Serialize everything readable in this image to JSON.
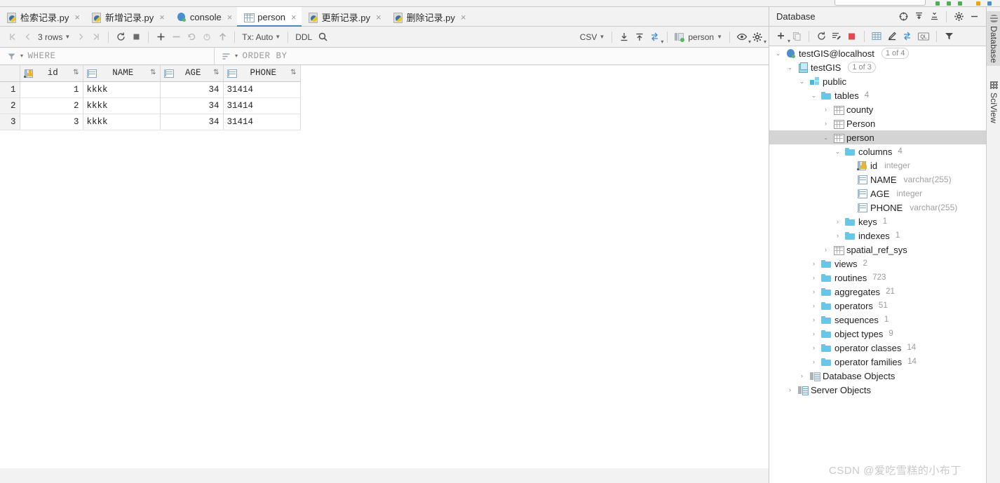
{
  "window": {
    "top_strip_dots": [
      "#4caf50",
      "#4caf50",
      "#4caf50",
      "#f0a500",
      "#4c8fce"
    ]
  },
  "editor_tabs": [
    {
      "label": "检索记录.py",
      "icon": "python-file-icon",
      "active": false,
      "close": "×"
    },
    {
      "label": "新增记录.py",
      "icon": "python-file-icon",
      "active": false,
      "close": "×"
    },
    {
      "label": "console",
      "icon": "postgres-console-icon",
      "active": false,
      "close": "×"
    },
    {
      "label": "person",
      "icon": "table-icon",
      "active": true,
      "close": "×"
    },
    {
      "label": "更新记录.py",
      "icon": "python-file-icon",
      "active": false,
      "close": "×"
    },
    {
      "label": "删除记录.py",
      "icon": "python-file-icon",
      "active": false,
      "close": "×"
    }
  ],
  "grid_toolbar": {
    "first_page": "|<",
    "prev_page": "<",
    "rows_label": "3 rows",
    "next_page": ">",
    "last_page": ">|",
    "reload": "reload-icon",
    "stop": "stop-icon",
    "add_row": "+",
    "delete_row": "−",
    "revert": "revert-icon",
    "revert_selected": "revert-selected-icon",
    "submit": "submit-icon",
    "tx_label": "Tx: Auto",
    "ddl_label": "DDL",
    "search": "search-icon",
    "format_label": "CSV",
    "import_label": "import-icon",
    "export_label": "export-icon",
    "compare_label": "compare-icon",
    "session_label": "person",
    "view_options": "eye-icon",
    "settings": "gear-icon"
  },
  "filter_bar": {
    "where_placeholder": "WHERE",
    "order_by_placeholder": "ORDER BY"
  },
  "table": {
    "columns": [
      {
        "name": "id",
        "icon": "primary-key-column-icon",
        "align": "right"
      },
      {
        "name": "NAME",
        "icon": "column-icon",
        "align": "left"
      },
      {
        "name": "AGE",
        "icon": "column-icon",
        "align": "right"
      },
      {
        "name": "PHONE",
        "icon": "column-icon",
        "align": "left"
      }
    ],
    "rows": [
      {
        "n": "1",
        "id": "1",
        "NAME": "kkkk",
        "AGE": "34",
        "PHONE": "31414"
      },
      {
        "n": "2",
        "id": "2",
        "NAME": "kkkk",
        "AGE": "34",
        "PHONE": "31414"
      },
      {
        "n": "3",
        "id": "3",
        "NAME": "kkkk",
        "AGE": "34",
        "PHONE": "31414"
      }
    ]
  },
  "database_panel": {
    "title": "Database",
    "header_buttons": [
      "jump-to-source-icon",
      "expand-all-icon",
      "collapse-all-icon",
      "gear-icon",
      "hide-icon"
    ],
    "toolbar_buttons": [
      "add-icon",
      "copy-icon",
      "refresh-icon",
      "sync-icon",
      "stop-icon",
      "table-editor-icon",
      "modify-icon",
      "jump-to-console-icon",
      "query-console-icon",
      "filter-icon"
    ],
    "tree": [
      {
        "depth": 0,
        "arrow": "⌄",
        "icon": "postgres-datasource-icon",
        "label": "testGIS@localhost",
        "badge": "1 of 4",
        "selected": false
      },
      {
        "depth": 1,
        "arrow": "⌄",
        "icon": "database-icon",
        "label": "testGIS",
        "badge": "1 of 3",
        "selected": false
      },
      {
        "depth": 2,
        "arrow": "⌄",
        "icon": "schema-icon",
        "label": "public",
        "selected": false
      },
      {
        "depth": 3,
        "arrow": "⌄",
        "icon": "folder-icon",
        "label": "tables",
        "count": "4",
        "selected": false
      },
      {
        "depth": 4,
        "arrow": "›",
        "icon": "table-icon",
        "label": "county",
        "selected": false
      },
      {
        "depth": 4,
        "arrow": "›",
        "icon": "table-icon",
        "label": "Person",
        "selected": false
      },
      {
        "depth": 4,
        "arrow": "⌄",
        "icon": "table-icon",
        "label": "person",
        "selected": true
      },
      {
        "depth": 5,
        "arrow": "⌄",
        "icon": "folder-icon",
        "label": "columns",
        "count": "4",
        "selected": false
      },
      {
        "depth": 6,
        "arrow": "",
        "icon": "primary-key-column-icon",
        "label": "id",
        "type": "integer",
        "selected": false
      },
      {
        "depth": 6,
        "arrow": "",
        "icon": "column-icon",
        "label": "NAME",
        "type": "varchar(255)",
        "selected": false
      },
      {
        "depth": 6,
        "arrow": "",
        "icon": "column-icon",
        "label": "AGE",
        "type": "integer",
        "selected": false
      },
      {
        "depth": 6,
        "arrow": "",
        "icon": "column-icon",
        "label": "PHONE",
        "type": "varchar(255)",
        "selected": false
      },
      {
        "depth": 5,
        "arrow": "›",
        "icon": "folder-icon",
        "label": "keys",
        "count": "1",
        "selected": false
      },
      {
        "depth": 5,
        "arrow": "›",
        "icon": "folder-icon",
        "label": "indexes",
        "count": "1",
        "selected": false
      },
      {
        "depth": 4,
        "arrow": "›",
        "icon": "table-icon",
        "label": "spatial_ref_sys",
        "selected": false
      },
      {
        "depth": 3,
        "arrow": "›",
        "icon": "folder-icon",
        "label": "views",
        "count": "2",
        "selected": false
      },
      {
        "depth": 3,
        "arrow": "›",
        "icon": "folder-icon",
        "label": "routines",
        "count": "723",
        "selected": false
      },
      {
        "depth": 3,
        "arrow": "›",
        "icon": "folder-icon",
        "label": "aggregates",
        "count": "21",
        "selected": false
      },
      {
        "depth": 3,
        "arrow": "›",
        "icon": "folder-icon",
        "label": "operators",
        "count": "51",
        "selected": false
      },
      {
        "depth": 3,
        "arrow": "›",
        "icon": "folder-icon",
        "label": "sequences",
        "count": "1",
        "selected": false
      },
      {
        "depth": 3,
        "arrow": "›",
        "icon": "folder-icon",
        "label": "object types",
        "count": "9",
        "selected": false
      },
      {
        "depth": 3,
        "arrow": "›",
        "icon": "folder-icon",
        "label": "operator classes",
        "count": "14",
        "selected": false
      },
      {
        "depth": 3,
        "arrow": "›",
        "icon": "folder-icon",
        "label": "operator families",
        "count": "14",
        "selected": false
      },
      {
        "depth": 2,
        "arrow": "›",
        "icon": "database-objects-icon",
        "label": "Database Objects",
        "selected": false
      },
      {
        "depth": 1,
        "arrow": "›",
        "icon": "server-objects-icon",
        "label": "Server Objects",
        "selected": false
      }
    ]
  },
  "right_stripe": [
    {
      "label": "Database",
      "icon": "database-stripe-icon",
      "active": true
    },
    {
      "label": "SciView",
      "icon": "sciview-stripe-icon",
      "active": false
    }
  ],
  "watermark": "CSDN @爱吃雪糕的小布丁"
}
